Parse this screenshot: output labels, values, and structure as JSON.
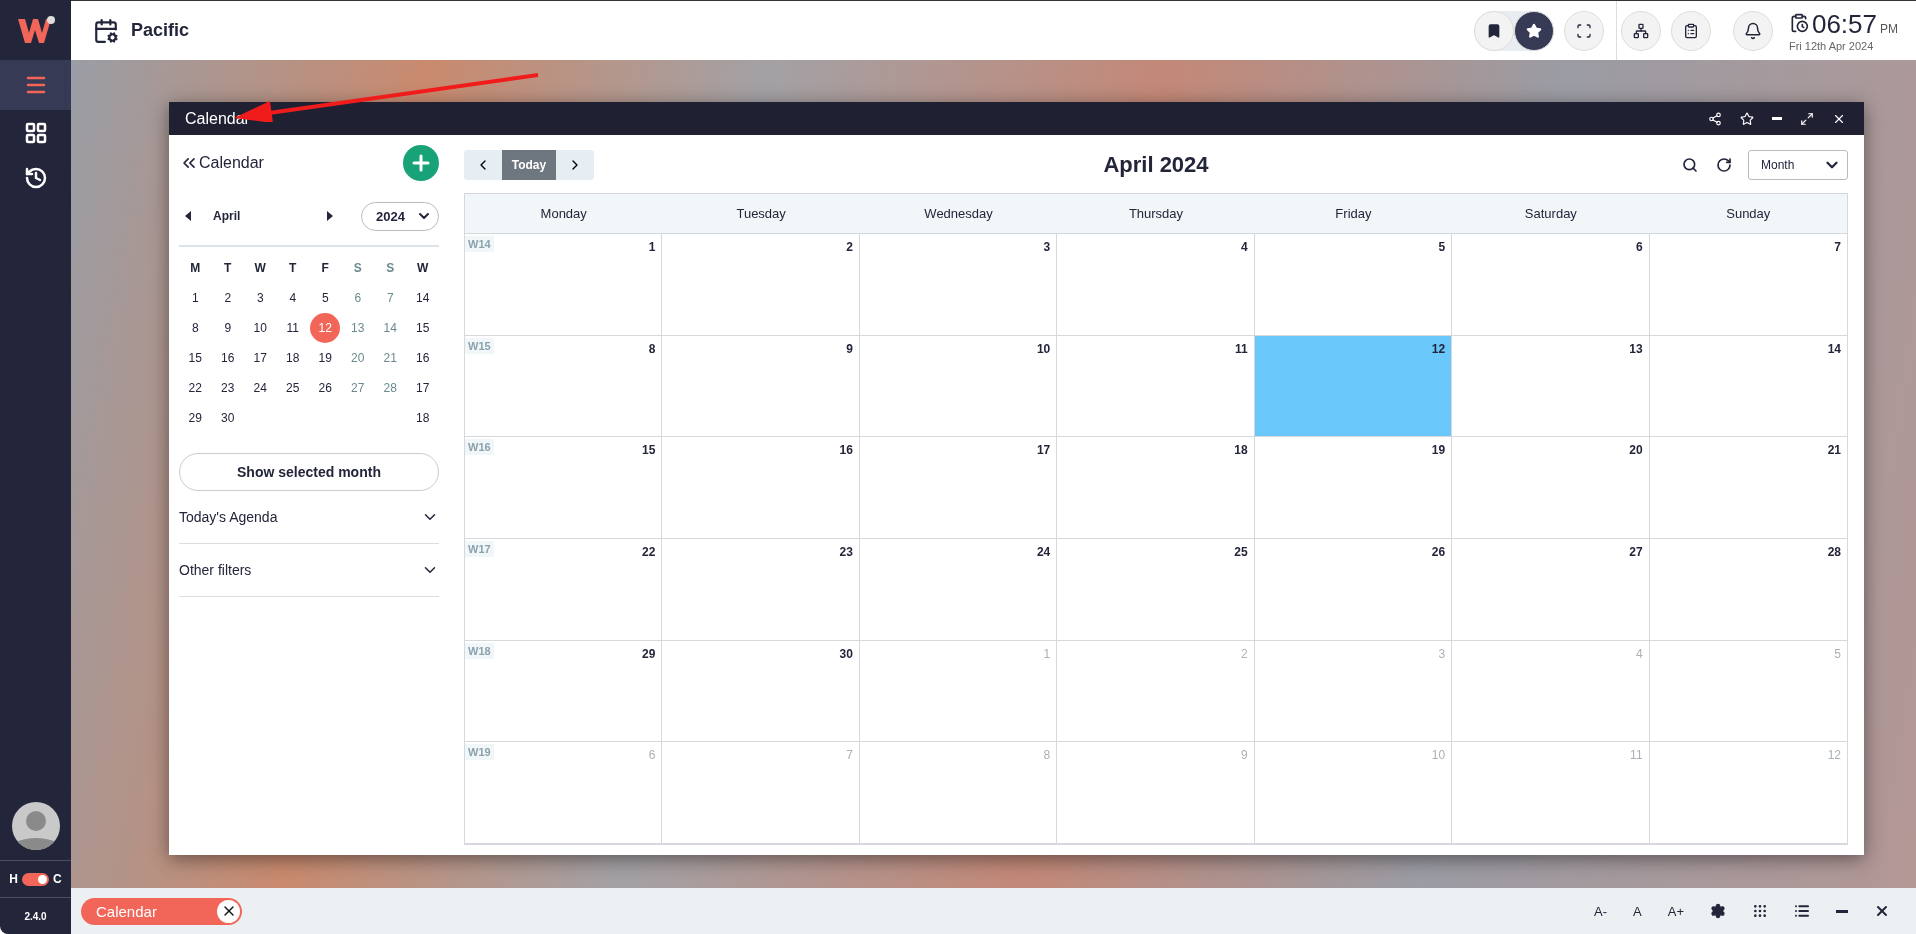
{
  "sidebar": {
    "nav": [
      {
        "selected": true
      },
      {
        "selected": false
      },
      {
        "selected": false
      }
    ],
    "theme_toggle": {
      "left": "H",
      "right": "C",
      "on": true
    },
    "version": "2.4.0"
  },
  "topbar": {
    "title": "Pacific",
    "pin_toggle": [
      {
        "selected": false
      },
      {
        "selected": true
      }
    ],
    "clock": {
      "time": "06:57",
      "meridiem": "PM",
      "date": "Fri 12th Apr 2024"
    }
  },
  "window": {
    "title": "Calendar",
    "side_panel": {
      "back_label": "Calendar",
      "month": "April",
      "year": "2024",
      "weekday_headers": [
        {
          "label": "M",
          "kind": "weekday"
        },
        {
          "label": "T",
          "kind": "weekday"
        },
        {
          "label": "W",
          "kind": "weekday"
        },
        {
          "label": "T",
          "kind": "weekday"
        },
        {
          "label": "F",
          "kind": "weekday"
        },
        {
          "label": "S",
          "kind": "weekend"
        },
        {
          "label": "S",
          "kind": "weekend"
        },
        {
          "label": "W",
          "kind": "week"
        }
      ],
      "weeks": [
        {
          "days": [
            {
              "label": "1",
              "weekend": false,
              "selected": false
            },
            {
              "label": "2",
              "weekend": false,
              "selected": false
            },
            {
              "label": "3",
              "weekend": false,
              "selected": false
            },
            {
              "label": "4",
              "weekend": false,
              "selected": false
            },
            {
              "label": "5",
              "weekend": false,
              "selected": false
            },
            {
              "label": "6",
              "weekend": true,
              "selected": false
            },
            {
              "label": "7",
              "weekend": true,
              "selected": false
            }
          ],
          "week": "14"
        },
        {
          "days": [
            {
              "label": "8",
              "weekend": false,
              "selected": false
            },
            {
              "label": "9",
              "weekend": false,
              "selected": false
            },
            {
              "label": "10",
              "weekend": false,
              "selected": false
            },
            {
              "label": "11",
              "weekend": false,
              "selected": false
            },
            {
              "label": "12",
              "weekend": false,
              "selected": true
            },
            {
              "label": "13",
              "weekend": true,
              "selected": false
            },
            {
              "label": "14",
              "weekend": true,
              "selected": false
            }
          ],
          "week": "15"
        },
        {
          "days": [
            {
              "label": "15",
              "weekend": false,
              "selected": false
            },
            {
              "label": "16",
              "weekend": false,
              "selected": false
            },
            {
              "label": "17",
              "weekend": false,
              "selected": false
            },
            {
              "label": "18",
              "weekend": false,
              "selected": false
            },
            {
              "label": "19",
              "weekend": false,
              "selected": false
            },
            {
              "label": "20",
              "weekend": true,
              "selected": false
            },
            {
              "label": "21",
              "weekend": true,
              "selected": false
            }
          ],
          "week": "16"
        },
        {
          "days": [
            {
              "label": "22",
              "weekend": false,
              "selected": false
            },
            {
              "label": "23",
              "weekend": false,
              "selected": false
            },
            {
              "label": "24",
              "weekend": false,
              "selected": false
            },
            {
              "label": "25",
              "weekend": false,
              "selected": false
            },
            {
              "label": "26",
              "weekend": false,
              "selected": false
            },
            {
              "label": "27",
              "weekend": true,
              "selected": false
            },
            {
              "label": "28",
              "weekend": true,
              "selected": false
            }
          ],
          "week": "17"
        },
        {
          "days": [
            {
              "label": "29",
              "weekend": false,
              "selected": false
            },
            {
              "label": "30",
              "weekend": false,
              "selected": false
            }
          ],
          "week": "18"
        }
      ],
      "show_button": "Show selected month",
      "sections": [
        {
          "label": "Today's Agenda",
          "expanded": false
        },
        {
          "label": "Other filters",
          "expanded": false
        }
      ]
    },
    "main": {
      "today_button": "Today",
      "title": "April 2024",
      "view": "Month",
      "columns": [
        "Monday",
        "Tuesday",
        "Wednesday",
        "Thursday",
        "Friday",
        "Saturday",
        "Sunday"
      ],
      "weeks": [
        {
          "label": "W14",
          "days": [
            {
              "label": "1",
              "in_month": true,
              "today": false
            },
            {
              "label": "2",
              "in_month": true,
              "today": false
            },
            {
              "label": "3",
              "in_month": true,
              "today": false
            },
            {
              "label": "4",
              "in_month": true,
              "today": false
            },
            {
              "label": "5",
              "in_month": true,
              "today": false
            },
            {
              "label": "6",
              "in_month": true,
              "today": false
            },
            {
              "label": "7",
              "in_month": true,
              "today": false
            }
          ]
        },
        {
          "label": "W15",
          "days": [
            {
              "label": "8",
              "in_month": true,
              "today": false
            },
            {
              "label": "9",
              "in_month": true,
              "today": false
            },
            {
              "label": "10",
              "in_month": true,
              "today": false
            },
            {
              "label": "11",
              "in_month": true,
              "today": false
            },
            {
              "label": "12",
              "in_month": true,
              "today": true
            },
            {
              "label": "13",
              "in_month": true,
              "today": false
            },
            {
              "label": "14",
              "in_month": true,
              "today": false
            }
          ]
        },
        {
          "label": "W16",
          "days": [
            {
              "label": "15",
              "in_month": true,
              "today": false
            },
            {
              "label": "16",
              "in_month": true,
              "today": false
            },
            {
              "label": "17",
              "in_month": true,
              "today": false
            },
            {
              "label": "18",
              "in_month": true,
              "today": false
            },
            {
              "label": "19",
              "in_month": true,
              "today": false
            },
            {
              "label": "20",
              "in_month": true,
              "today": false
            },
            {
              "label": "21",
              "in_month": true,
              "today": false
            }
          ]
        },
        {
          "label": "W17",
          "days": [
            {
              "label": "22",
              "in_month": true,
              "today": false
            },
            {
              "label": "23",
              "in_month": true,
              "today": false
            },
            {
              "label": "24",
              "in_month": true,
              "today": false
            },
            {
              "label": "25",
              "in_month": true,
              "today": false
            },
            {
              "label": "26",
              "in_month": true,
              "today": false
            },
            {
              "label": "27",
              "in_month": true,
              "today": false
            },
            {
              "label": "28",
              "in_month": true,
              "today": false
            }
          ]
        },
        {
          "label": "W18",
          "days": [
            {
              "label": "29",
              "in_month": true,
              "today": false
            },
            {
              "label": "30",
              "in_month": true,
              "today": false
            },
            {
              "label": "1",
              "in_month": false,
              "today": false
            },
            {
              "label": "2",
              "in_month": false,
              "today": false
            },
            {
              "label": "3",
              "in_month": false,
              "today": false
            },
            {
              "label": "4",
              "in_month": false,
              "today": false
            },
            {
              "label": "5",
              "in_month": false,
              "today": false
            }
          ]
        },
        {
          "label": "W19",
          "days": [
            {
              "label": "6",
              "in_month": false,
              "today": false
            },
            {
              "label": "7",
              "in_month": false,
              "today": false
            },
            {
              "label": "8",
              "in_month": false,
              "today": false
            },
            {
              "label": "9",
              "in_month": false,
              "today": false
            },
            {
              "label": "10",
              "in_month": false,
              "today": false
            },
            {
              "label": "11",
              "in_month": false,
              "today": false
            },
            {
              "label": "12",
              "in_month": false,
              "today": false
            }
          ]
        }
      ]
    }
  },
  "taskbar": {
    "tasks": [
      {
        "label": "Calendar",
        "selected": true
      }
    ],
    "font_controls": [
      "A-",
      "A",
      "A+"
    ]
  }
}
